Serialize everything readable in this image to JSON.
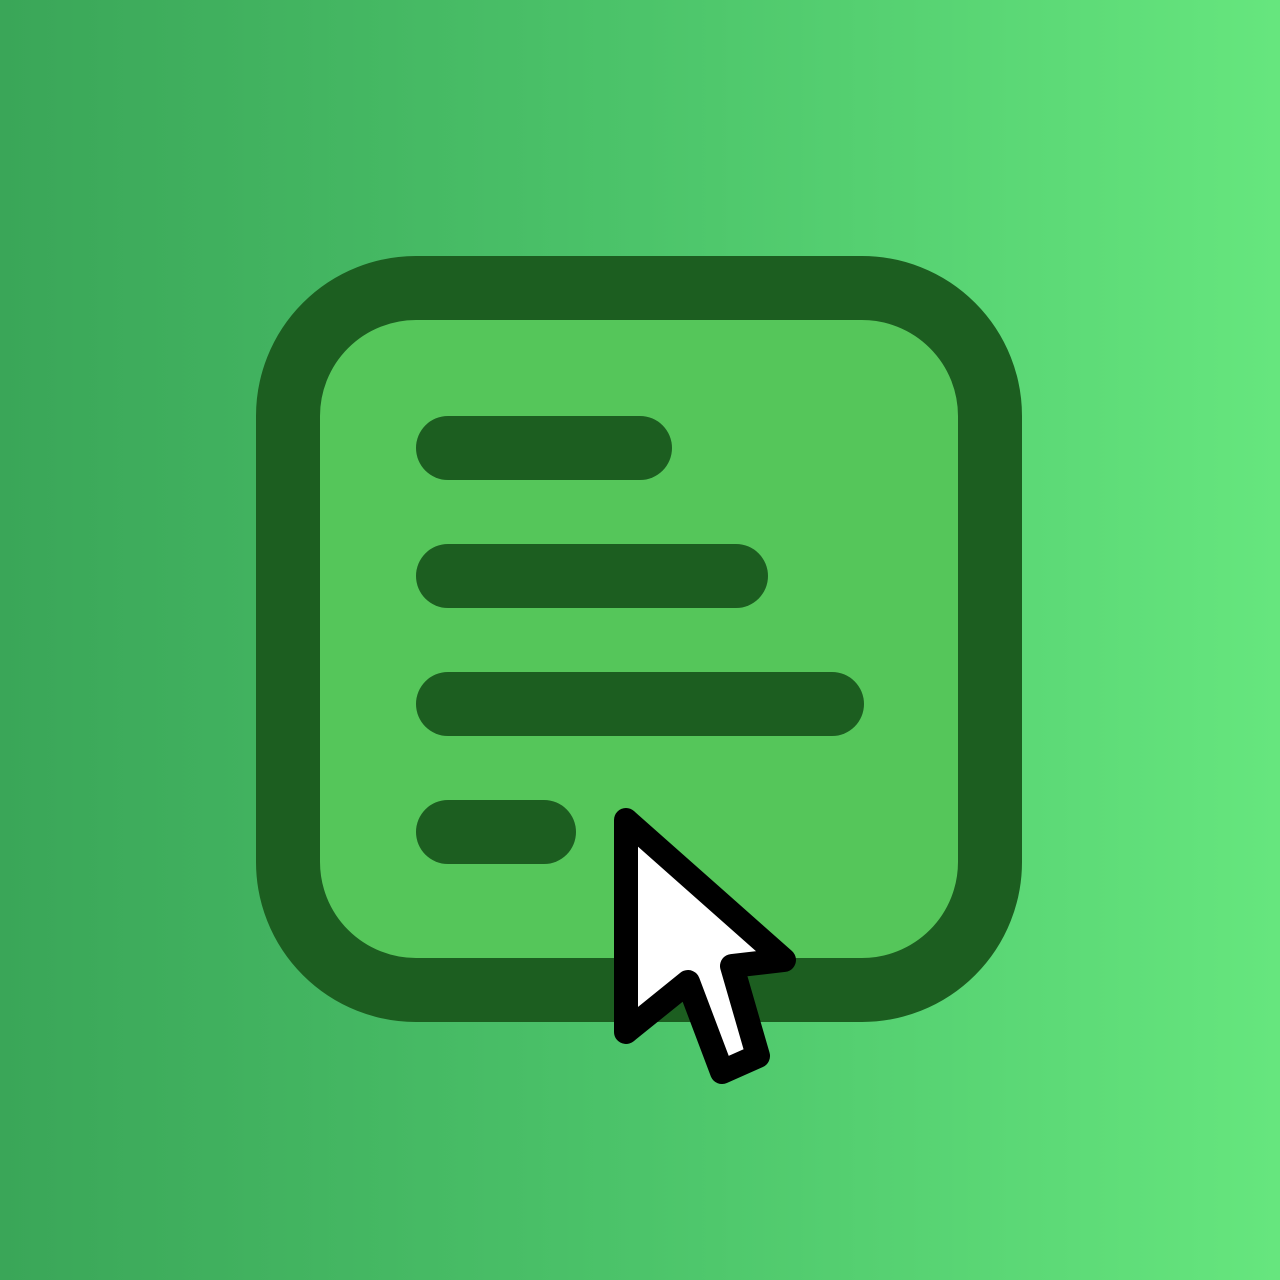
{
  "app_icon": {
    "name": "document-lines-icon",
    "frame_color": "#1c5e20",
    "fill_color": "#55c65a",
    "text_lines": 4
  },
  "background": {
    "gradient_start": "#3aa658",
    "gradient_end": "#66e67e"
  },
  "cursor": {
    "name": "mouse-pointer-icon",
    "fill_color": "#ffffff",
    "outline_color": "#000000"
  }
}
